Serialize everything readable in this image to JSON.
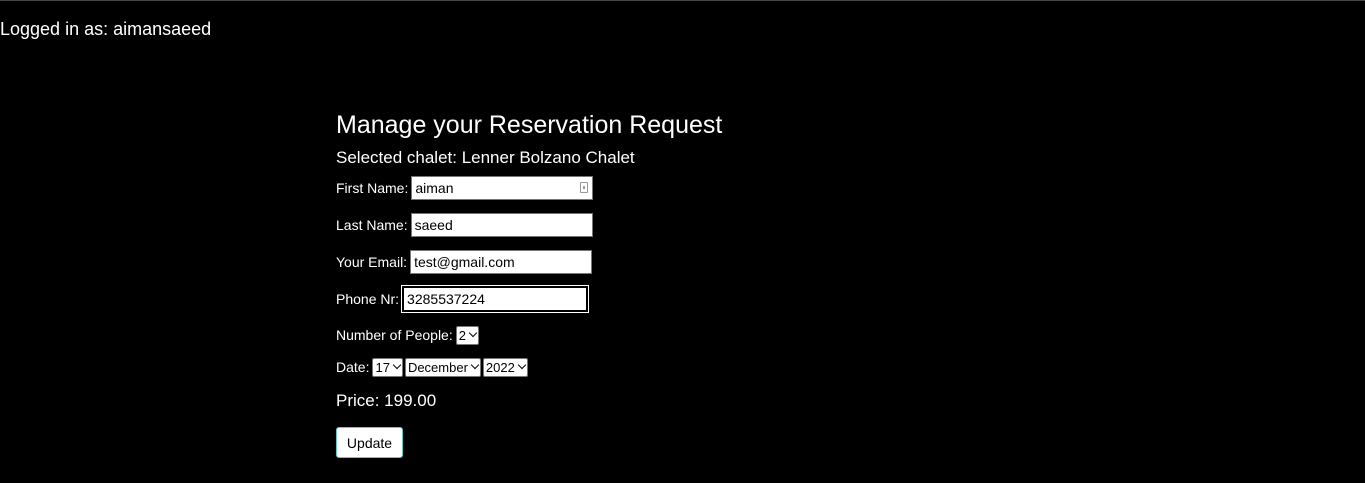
{
  "header": {
    "logged_in_text": "Logged in as: aimansaeed"
  },
  "form": {
    "title": "Manage your Reservation Request",
    "selected_chalet": "Selected chalet: Lenner Bolzano Chalet",
    "first_name": {
      "label": "First Name:",
      "value": "aiman"
    },
    "last_name": {
      "label": "Last Name:",
      "value": "saeed"
    },
    "email": {
      "label": "Your Email:",
      "value": "test@gmail.com"
    },
    "phone": {
      "label": "Phone Nr:",
      "value": "3285537224"
    },
    "people": {
      "label": "Number of People:",
      "value": "2"
    },
    "date": {
      "label": "Date:",
      "day": "17",
      "month": "December",
      "year": "2022"
    },
    "price": "Price: 199.00",
    "update_label": "Update"
  },
  "colors": {
    "background": "#000000",
    "text": "#ffffff",
    "button_border": "#5fc9d1"
  }
}
